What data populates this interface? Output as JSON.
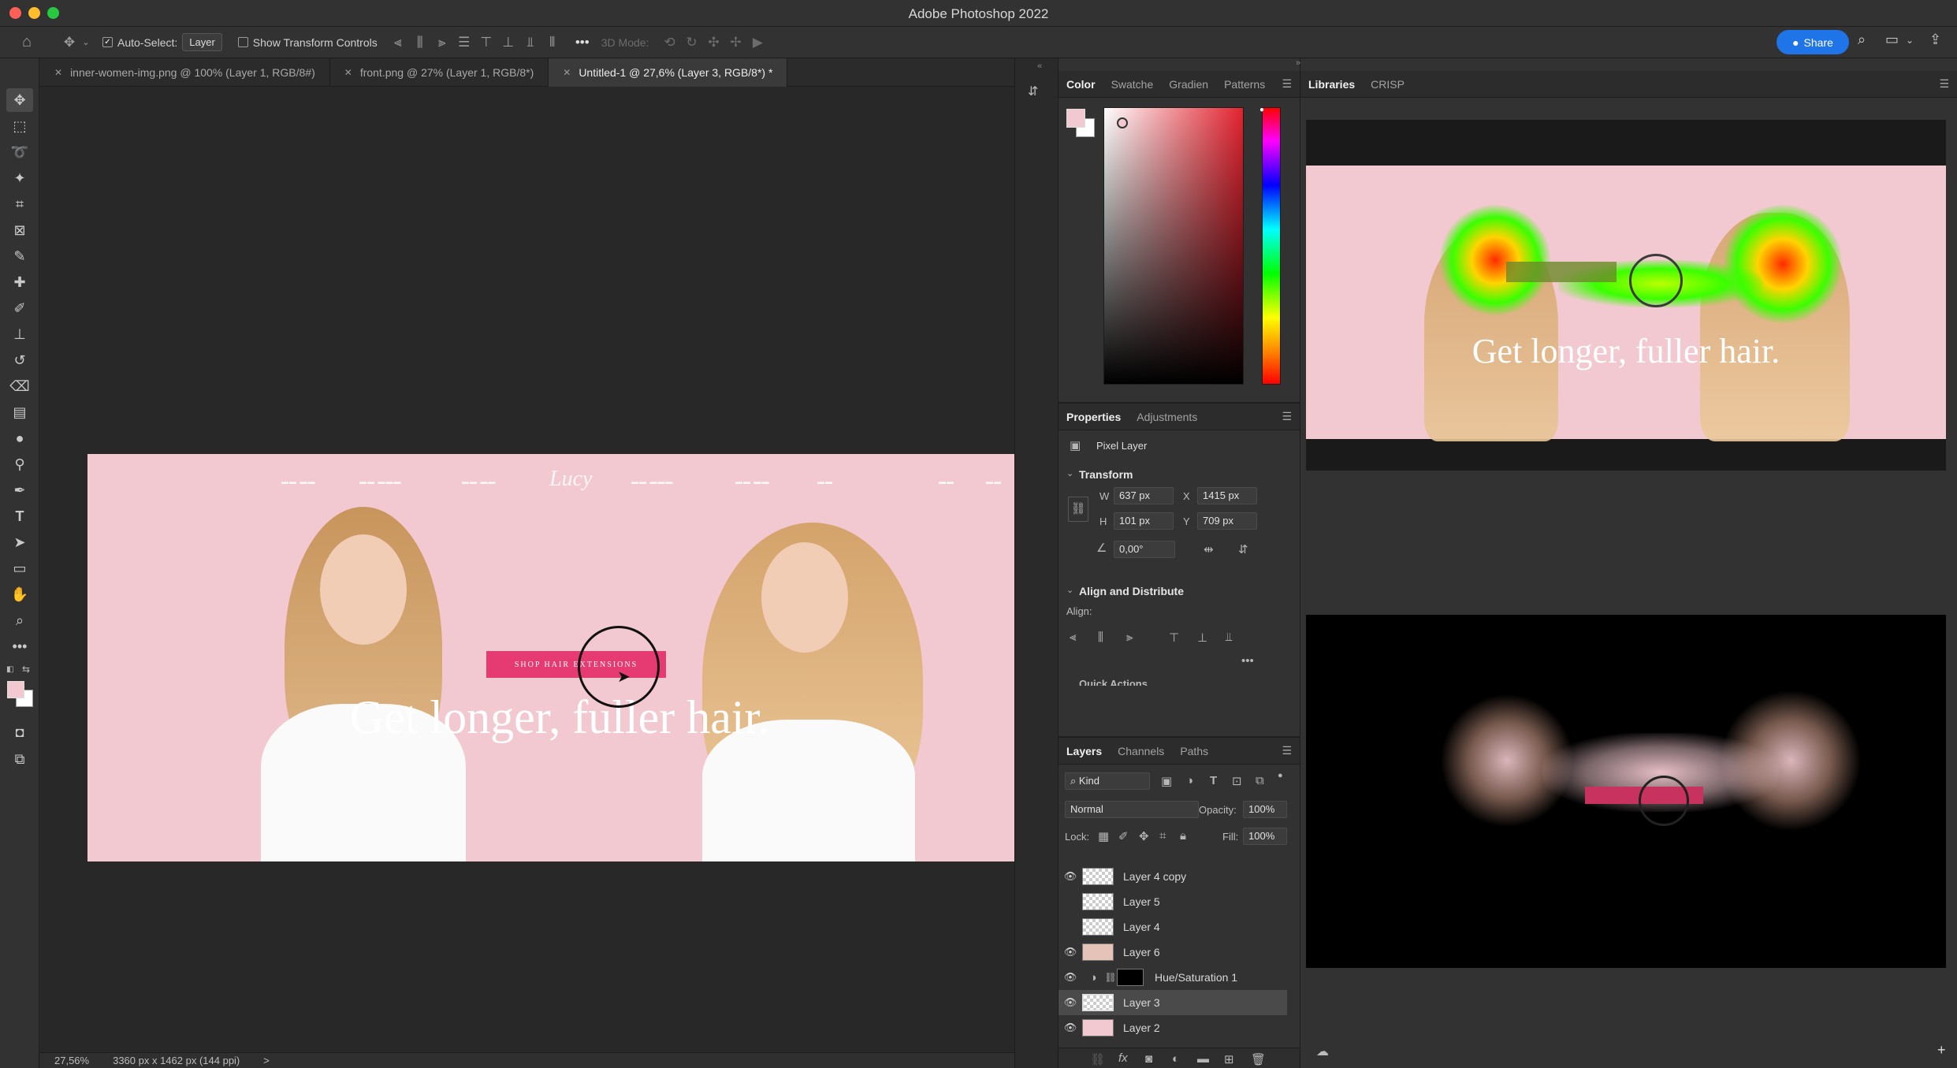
{
  "window": {
    "title": "Adobe Photoshop 2022"
  },
  "options_bar": {
    "auto_select_label": "Auto-Select:",
    "auto_select_value": "Layer",
    "show_transform_label": "Show Transform Controls",
    "mode_3d_label": "3D Mode:",
    "share_label": "Share"
  },
  "doc_tabs": [
    {
      "label": "inner-women-img.png @ 100% (Layer 1, RGB/8#)"
    },
    {
      "label": "front.png @ 27% (Layer 1, RGB/8*)"
    },
    {
      "label": "Untitled-1 @ 27,6% (Layer 3, RGB/8*) *"
    }
  ],
  "canvas": {
    "cta_label": "SHOP HAIR EXTENSIONS",
    "headline": "Get longer, fuller hair.",
    "brand": "Lucy"
  },
  "status": {
    "zoom": "27,56%",
    "size": "3360 px x 1462 px (144 ppi)",
    "arrow": ">"
  },
  "color_panel": {
    "tabs": [
      "Color",
      "Swatche",
      "Gradien",
      "Patterns"
    ],
    "fg_color": "#f2c9d0",
    "bg_color": "#ffffff"
  },
  "properties": {
    "tabs": [
      "Properties",
      "Adjustments"
    ],
    "layer_type": "Pixel Layer",
    "transform_title": "Transform",
    "w_label": "W",
    "w_value": "637 px",
    "x_label": "X",
    "x_value": "1415 px",
    "h_label": "H",
    "h_value": "101 px",
    "y_label": "Y",
    "y_value": "709 px",
    "angle_value": "0,00°",
    "align_title": "Align and Distribute",
    "align_label": "Align:",
    "quick_actions": "Quick Actions"
  },
  "layers_panel": {
    "tabs": [
      "Layers",
      "Channels",
      "Paths"
    ],
    "filter_kind": "Kind",
    "blend_mode": "Normal",
    "opacity_label": "Opacity:",
    "opacity_value": "100%",
    "lock_label": "Lock:",
    "fill_label": "Fill:",
    "fill_value": "100%",
    "layers": [
      {
        "name": "Layer 4 copy",
        "visible": true
      },
      {
        "name": "Layer 5",
        "visible": false
      },
      {
        "name": "Layer 4",
        "visible": false
      },
      {
        "name": "Layer 6",
        "visible": true
      },
      {
        "name": "Hue/Saturation 1",
        "visible": true,
        "adjustment": true
      },
      {
        "name": "Layer 3",
        "visible": true,
        "selected": true
      },
      {
        "name": "Layer 2",
        "visible": true
      }
    ]
  },
  "libraries": {
    "tabs": [
      "Libraries",
      "CRISP"
    ]
  }
}
